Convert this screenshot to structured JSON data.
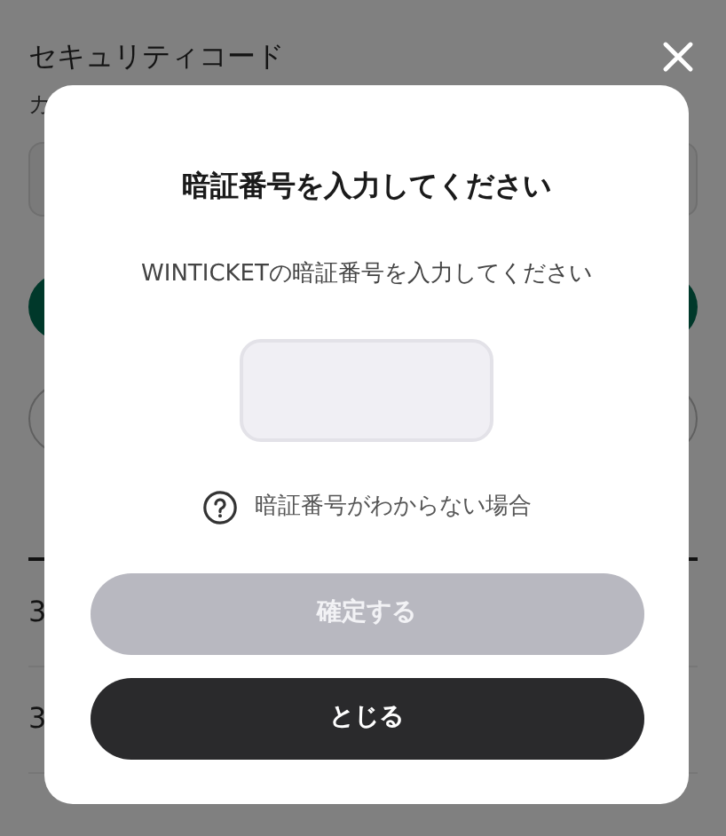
{
  "background": {
    "title": "セキュリティコード",
    "subtitle": "カ",
    "rows": [
      "3",
      "3"
    ]
  },
  "dialog": {
    "title": "暗証番号を入力してください",
    "message": "WINTICKETの暗証番号を入力してください",
    "help_link": "暗証番号がわからない場合",
    "confirm_button": {
      "label": "確定する",
      "disabled": true
    },
    "close_button": {
      "label": "とじる"
    }
  }
}
